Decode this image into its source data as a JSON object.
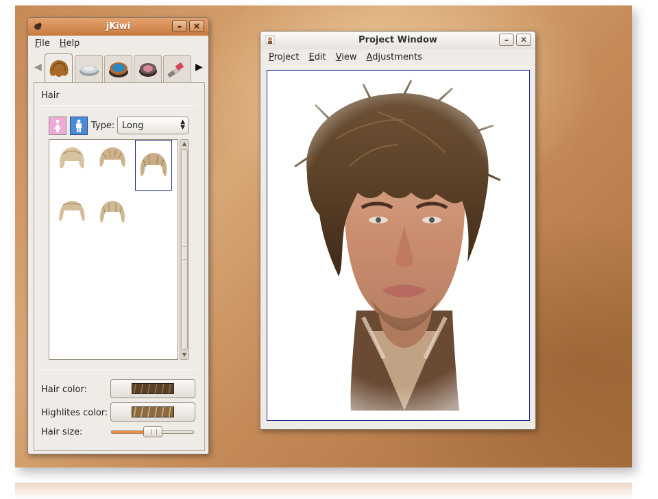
{
  "jkiwi": {
    "title": "jKiwi",
    "menu": {
      "file": "File",
      "help": "Help"
    },
    "tabs": [
      {
        "icon": "hair-icon",
        "active": true
      },
      {
        "icon": "powder-compact-icon",
        "active": false
      },
      {
        "icon": "eyeshadow-icon",
        "active": false
      },
      {
        "icon": "blush-icon",
        "active": false
      },
      {
        "icon": "lipstick-icon",
        "active": false
      }
    ],
    "panel": {
      "title": "Hair",
      "type_label": "Type:",
      "type_value": "Long",
      "hairstyles_count": 5,
      "selected_index": 2,
      "hair_color_label": "Hair color:",
      "hair_color": "#5a4026",
      "highlites_color_label": "Highlites color:",
      "highlites_color": "#8a6a40",
      "hair_size_label": "Hair size:",
      "hair_size_value": 0.5
    }
  },
  "project": {
    "title": "Project Window",
    "menu": {
      "project": "Project",
      "edit": "Edit",
      "view": "View",
      "adjustments": "Adjustments"
    }
  },
  "colors": {
    "accent": "#f08a3a",
    "selection_border": "#1b2a8a",
    "titlebar_orange": "#d28c55"
  }
}
